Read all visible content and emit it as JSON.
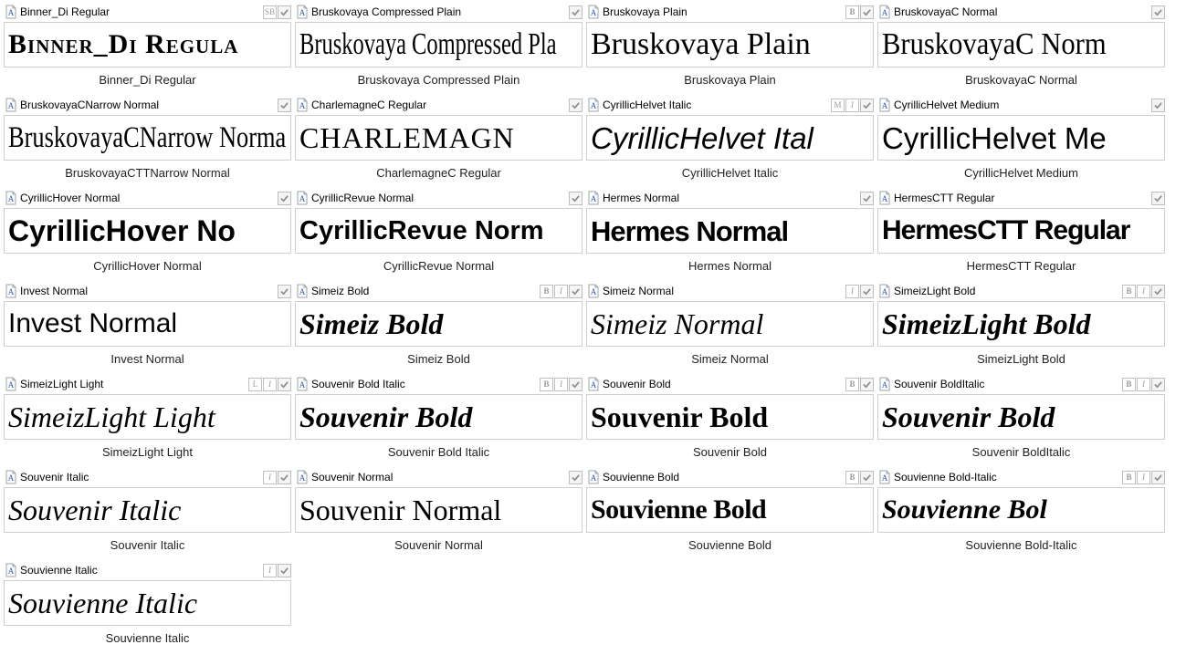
{
  "fonts": [
    {
      "name": "Binner_Di Regular",
      "preview": "Binner_Di Regula",
      "caption": "Binner_Di Regular",
      "badges": [
        "SB",
        "check"
      ],
      "cls": "pf-binner"
    },
    {
      "name": "Bruskovaya Compressed Plain",
      "preview": "Bruskovaya Compressed Pla",
      "caption": "Bruskovaya Compressed Plain",
      "badges": [
        "check"
      ],
      "cls": "pf-brusk-c"
    },
    {
      "name": "Bruskovaya Plain",
      "preview": "Bruskovaya Plain",
      "caption": "Bruskovaya Plain",
      "badges": [
        "B",
        "check"
      ],
      "cls": "pf-brusk"
    },
    {
      "name": "BruskovayaC Normal",
      "preview": "BruskovayaC Norm",
      "caption": "BruskovayaC Normal",
      "badges": [
        "check"
      ],
      "cls": "pf-bruskc"
    },
    {
      "name": "BruskovayaCNarrow Normal",
      "preview": "BruskovayaCNarrow Norma",
      "caption": "BruskovayaCTTNarrow Normal",
      "badges": [
        "check"
      ],
      "cls": "pf-bruskcn"
    },
    {
      "name": "CharlemagneC Regular",
      "preview": "CHARLEMAGN",
      "caption": "CharlemagneC Regular",
      "badges": [
        "check"
      ],
      "cls": "pf-charle"
    },
    {
      "name": "CyrillicHelvet Italic",
      "preview": "CyrillicHelvet Ital",
      "caption": "CyrillicHelvet Italic",
      "badges": [
        "M",
        "I",
        "check"
      ],
      "cls": "pf-helvet-i"
    },
    {
      "name": "CyrillicHelvet Medium",
      "preview": "CyrillicHelvet Me",
      "caption": "CyrillicHelvet Medium",
      "badges": [
        "check"
      ],
      "cls": "pf-helvet-m"
    },
    {
      "name": "CyrillicHover Normal",
      "preview": "CyrillicHover No",
      "caption": "CyrillicHover Normal",
      "badges": [
        "check"
      ],
      "cls": "pf-hover"
    },
    {
      "name": "CyrillicRevue Normal",
      "preview": "CyrillicRevue Norm",
      "caption": "CyrillicRevue Normal",
      "badges": [
        "check"
      ],
      "cls": "pf-revue"
    },
    {
      "name": "Hermes Normal",
      "preview": "Hermes Normal",
      "caption": "Hermes Normal",
      "badges": [
        "check"
      ],
      "cls": "pf-hermes"
    },
    {
      "name": "HermesCTT Regular",
      "preview": "HermesCTT Regular",
      "caption": "HermesCTT Regular",
      "badges": [
        "check"
      ],
      "cls": "pf-hermesc"
    },
    {
      "name": "Invest Normal",
      "preview": "Invest   Normal",
      "caption": "Invest Normal",
      "badges": [
        "check"
      ],
      "cls": "pf-invest"
    },
    {
      "name": "Simeiz Bold",
      "preview": "Simeiz  Bold",
      "caption": "Simeiz Bold",
      "badges": [
        "B",
        "I",
        "check"
      ],
      "cls": "pf-simeiz-b"
    },
    {
      "name": "Simeiz Normal",
      "preview": "Simeiz  Normal",
      "caption": "Simeiz Normal",
      "badges": [
        "I",
        "check"
      ],
      "cls": "pf-simeiz-n"
    },
    {
      "name": "SimeizLight Bold",
      "preview": "SimeizLight  Bold",
      "caption": "SimeizLight Bold",
      "badges": [
        "B",
        "I",
        "check"
      ],
      "cls": "pf-simeizl-b"
    },
    {
      "name": "SimeizLight Light",
      "preview": "SimeizLight  Light",
      "caption": "SimeizLight Light",
      "badges": [
        "L",
        "I",
        "check"
      ],
      "cls": "pf-simeizl-l"
    },
    {
      "name": "Souvenir Bold Italic",
      "preview": "Souvenir  Bold",
      "caption": "Souvenir Bold Italic",
      "badges": [
        "B",
        "I",
        "check"
      ],
      "cls": "pf-souv-bi"
    },
    {
      "name": "Souvenir Bold",
      "preview": "Souvenir Bold",
      "caption": "Souvenir Bold",
      "badges": [
        "B",
        "check"
      ],
      "cls": "pf-souv-b"
    },
    {
      "name": "Souvenir BoldItalic",
      "preview": "Souvenir Bold",
      "caption": "Souvenir BoldItalic",
      "badges": [
        "B",
        "I",
        "check"
      ],
      "cls": "pf-souv-bi2"
    },
    {
      "name": "Souvenir Italic",
      "preview": "Souvenir Italic",
      "caption": "Souvenir Italic",
      "badges": [
        "I",
        "check"
      ],
      "cls": "pf-souv-i"
    },
    {
      "name": "Souvenir Normal",
      "preview": "Souvenir Normal",
      "caption": "Souvenir Normal",
      "badges": [
        "check"
      ],
      "cls": "pf-souv-n"
    },
    {
      "name": "Souvienne Bold",
      "preview": "Souvienne Bold",
      "caption": "Souvienne Bold",
      "badges": [
        "B",
        "check"
      ],
      "cls": "pf-souvi-b"
    },
    {
      "name": "Souvienne Bold-Italic",
      "preview": "Souvienne Bol",
      "caption": "Souvienne Bold-Italic",
      "badges": [
        "B",
        "I",
        "check"
      ],
      "cls": "pf-souvi-bi"
    },
    {
      "name": "Souvienne Italic",
      "preview": "Souvienne Italic",
      "caption": "Souvienne Italic",
      "badges": [
        "I",
        "check"
      ],
      "cls": "pf-souvi-i"
    }
  ]
}
